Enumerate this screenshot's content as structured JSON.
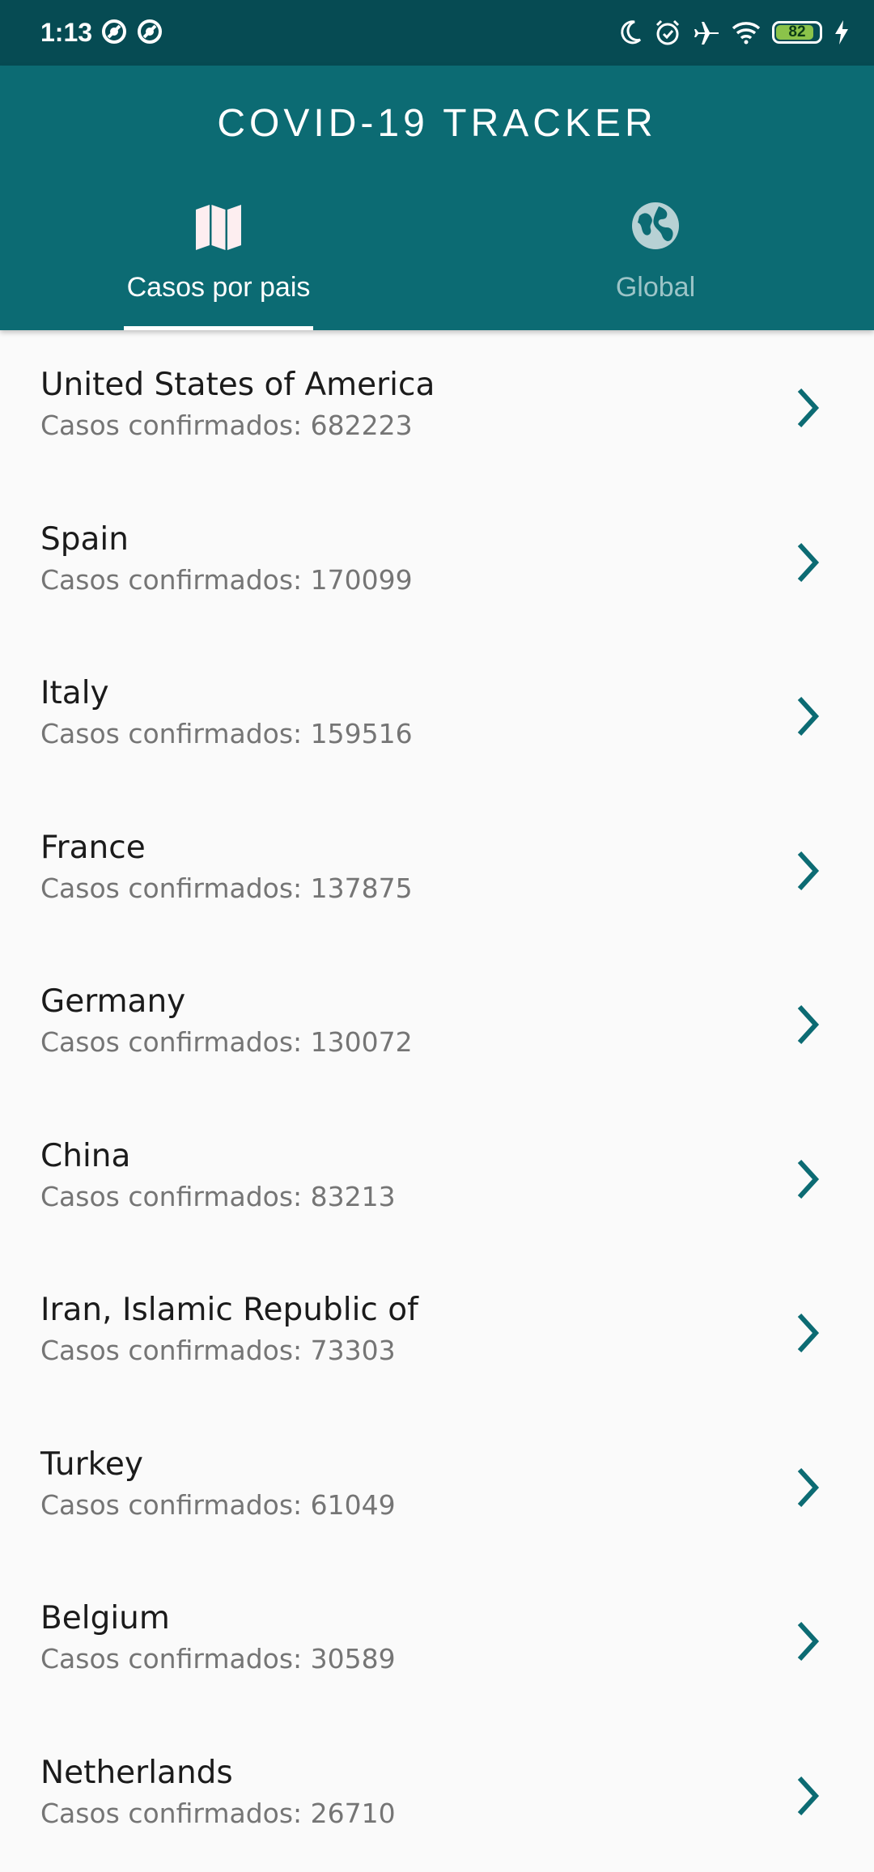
{
  "status_bar": {
    "time": "1:13",
    "battery_level": "82",
    "icons": [
      "sync-icon",
      "sync-icon",
      "moon-icon",
      "alarm-icon",
      "airplane-icon",
      "wifi-icon",
      "battery-icon",
      "charging-icon"
    ]
  },
  "header": {
    "title": "COVID-19 TRACKER"
  },
  "tabs": [
    {
      "label": "Casos por pais",
      "icon": "map-icon",
      "active": true
    },
    {
      "label": "Global",
      "icon": "globe-icon",
      "active": false
    }
  ],
  "countries": [
    {
      "name": "United States of America",
      "cases": "Casos confirmados: 682223"
    },
    {
      "name": "Spain",
      "cases": "Casos confirmados: 170099"
    },
    {
      "name": "Italy",
      "cases": "Casos confirmados: 159516"
    },
    {
      "name": "France",
      "cases": "Casos confirmados: 137875"
    },
    {
      "name": "Germany",
      "cases": "Casos confirmados: 130072"
    },
    {
      "name": "China",
      "cases": "Casos confirmados: 83213"
    },
    {
      "name": "Iran, Islamic Republic of",
      "cases": "Casos confirmados: 73303"
    },
    {
      "name": "Turkey",
      "cases": "Casos confirmados: 61049"
    },
    {
      "name": "Belgium",
      "cases": "Casos confirmados: 30589"
    },
    {
      "name": "Netherlands",
      "cases": "Casos confirmados: 26710"
    }
  ],
  "colors": {
    "status_bar": "#064b53",
    "header": "#0c6b73",
    "accent": "#0c6b73",
    "background": "#fafafa"
  }
}
